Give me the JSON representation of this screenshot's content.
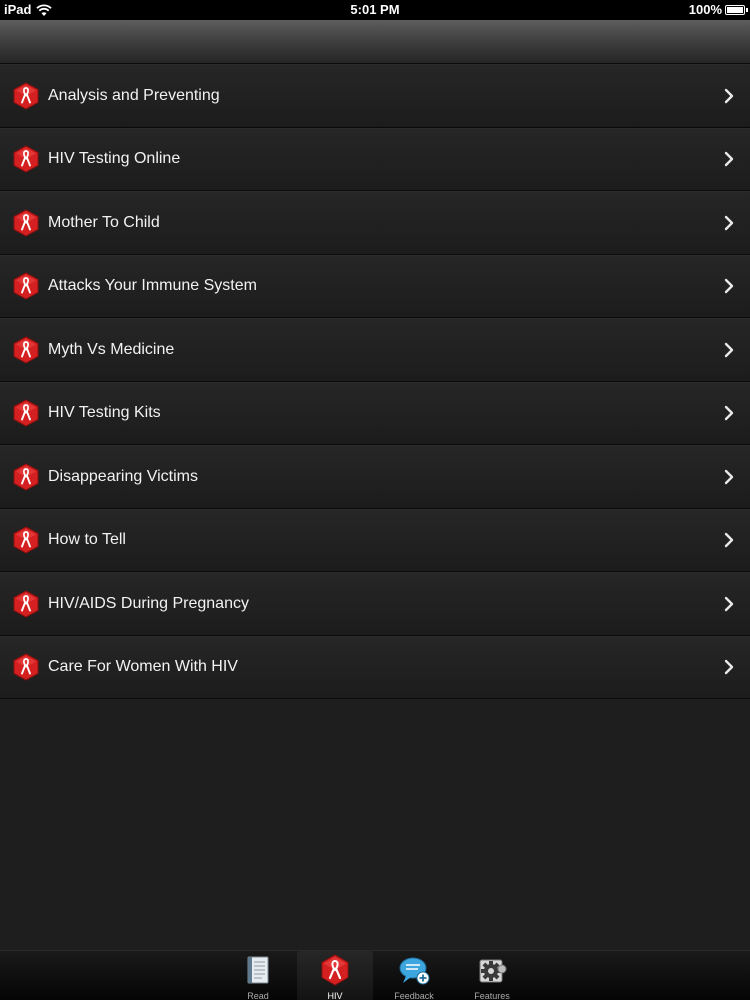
{
  "status_bar": {
    "carrier": "iPad",
    "time": "5:01 PM",
    "battery": "100%"
  },
  "list": {
    "items": [
      {
        "label": "Analysis and Preventing"
      },
      {
        "label": "HIV Testing Online"
      },
      {
        "label": "Mother To Child"
      },
      {
        "label": "Attacks Your Immune System"
      },
      {
        "label": "Myth Vs Medicine"
      },
      {
        "label": "HIV Testing Kits"
      },
      {
        "label": "Disappearing Victims"
      },
      {
        "label": "How to Tell"
      },
      {
        "label": "HIV/AIDS During Pregnancy"
      },
      {
        "label": "Care For Women With HIV"
      }
    ],
    "item_icon": "red-ribbon-hexagon-icon",
    "chevron_icon": "chevron-right-icon"
  },
  "tab_bar": {
    "tabs": [
      {
        "label": "Read",
        "icon": "book-icon"
      },
      {
        "label": "HIV",
        "icon": "red-ribbon-hexagon-icon",
        "active": true
      },
      {
        "label": "Feedback",
        "icon": "speech-bubble-icon"
      },
      {
        "label": "Features",
        "icon": "gear-icon"
      }
    ]
  },
  "colors": {
    "accent_red": "#d42020",
    "list_background": "#1e1e1e",
    "text": "#f2f2f2"
  }
}
